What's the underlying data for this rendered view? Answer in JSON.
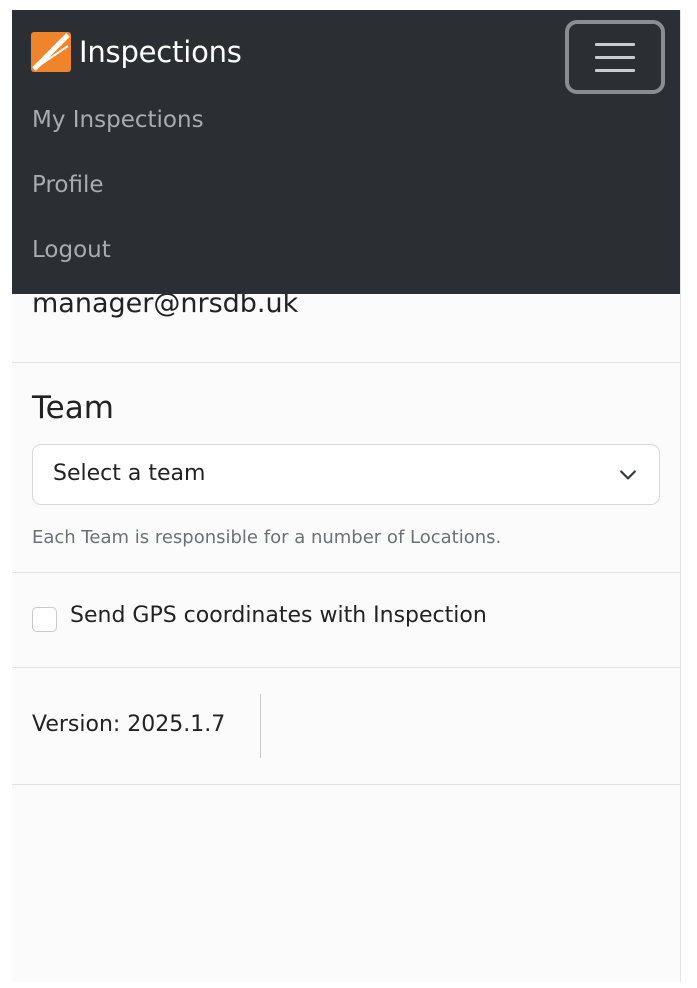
{
  "navbar": {
    "brand": "Inspections",
    "logo_icon": "app-logo-icon",
    "toggle_icon": "hamburger-menu-icon",
    "links": [
      {
        "label": "My Inspections"
      },
      {
        "label": "Profile"
      },
      {
        "label": "Logout"
      }
    ],
    "colors": {
      "background": "#2b2f34",
      "logo_orange": "#f0842a",
      "link": "#a8abaf"
    }
  },
  "user": {
    "email": "manager@nrsdb.uk"
  },
  "team": {
    "label": "Team",
    "select_value": "Select a team",
    "chevron_icon": "chevron-down-icon",
    "help_text": "Each Team is responsible for a number of Locations."
  },
  "gps": {
    "label": "Send GPS coordinates with Inspection",
    "checked": false
  },
  "version": {
    "text": "Version: 2025.1.7"
  }
}
